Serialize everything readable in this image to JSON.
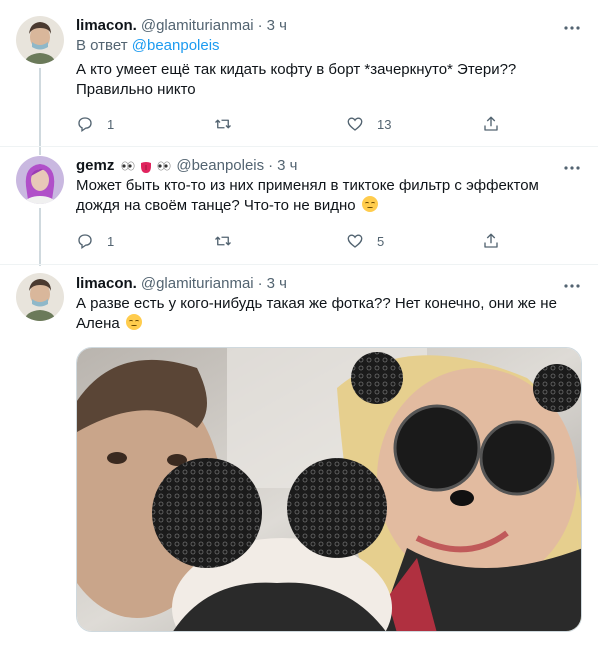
{
  "tweets": [
    {
      "name": "limacon.",
      "handle": "@glamiturianmai",
      "dot": "·",
      "time": "3 ч",
      "reply_prefix": "В ответ",
      "reply_handle": "@beanpoleis",
      "text_line1": "А кто умеет ещё так кидать кофту в борт *зачеркнуто* Этери??",
      "text_line2": "Правильно никто",
      "replies": "1",
      "retweets": "",
      "likes": "13"
    },
    {
      "name": "gemz",
      "handle": "@beanpoleis",
      "dot": "·",
      "time": "3 ч",
      "text_line1": "Может быть кто-то из них применял в тиктоке фильтр с эффектом",
      "text_line2": "дождя на своём танце? Что-то не видно",
      "replies": "1",
      "retweets": "",
      "likes": "5"
    },
    {
      "name": "limacon.",
      "handle": "@glamiturianmai",
      "dot": "·",
      "time": "3 ч",
      "text_line1": "А разве есть у кого-нибудь такая же фотка?? Нет конечно, они же не",
      "text_line2": "Алена"
    }
  ],
  "icons": [
    "reply-icon",
    "retweet-icon",
    "like-icon",
    "share-icon",
    "more-icon"
  ],
  "colors": {
    "link": "#1d9bf0",
    "secondary": "#536471",
    "text": "#0f1419",
    "divider": "#eff3f4"
  }
}
